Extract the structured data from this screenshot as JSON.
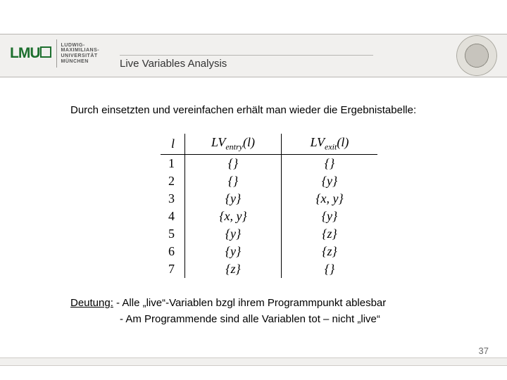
{
  "logo": {
    "letters": "LMU",
    "subtitle_line1": "Ludwig-",
    "subtitle_line2": "Maximilians-",
    "subtitle_line3": "Universität",
    "subtitle_line4": "München"
  },
  "header": {
    "title": "Live Variables Analysis"
  },
  "body": {
    "lead": "Durch einsetzten und vereinfachen erhält man wieder die Ergebnistabelle:"
  },
  "table": {
    "col_l": "l",
    "col_entry_prefix": "LV",
    "col_entry_sub": "entry",
    "col_entry_arg": "(l)",
    "col_exit_prefix": "LV",
    "col_exit_sub": "exit",
    "col_exit_arg": "(l)",
    "rows": [
      {
        "l": "1",
        "entry": "{}",
        "exit": "{}"
      },
      {
        "l": "2",
        "entry": "{}",
        "exit": "{y}"
      },
      {
        "l": "3",
        "entry": "{y}",
        "exit": "{x, y}"
      },
      {
        "l": "4",
        "entry": "{x, y}",
        "exit": "{y}"
      },
      {
        "l": "5",
        "entry": "{y}",
        "exit": "{z}"
      },
      {
        "l": "6",
        "entry": "{y}",
        "exit": "{z}"
      },
      {
        "l": "7",
        "entry": "{z}",
        "exit": "{}"
      }
    ]
  },
  "interp": {
    "label": "Deutung:",
    "line1_rest": " - Alle „live“-Variablen bzgl ihrem Programmpunkt ablesbar",
    "line2": "- Am Programmende sind alle Variablen tot – nicht „live“"
  },
  "footer": {
    "page": "37"
  }
}
